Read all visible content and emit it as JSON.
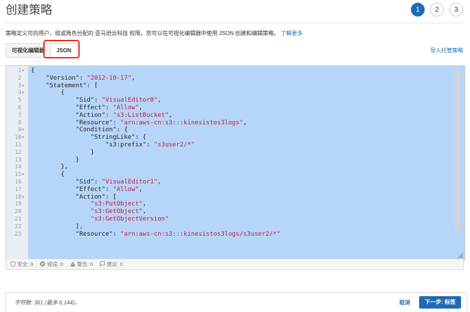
{
  "header": {
    "title": "创建策略",
    "steps": [
      "1",
      "2",
      "3"
    ]
  },
  "description": {
    "text": "策略定义可向用户、组或角色分配的 亚马逊云科技 权限。您可以在可视化编辑器中使用 JSON 创建和编辑策略。",
    "link": "了解更多"
  },
  "tabs": {
    "visual": "可视化编辑器",
    "json": "JSON"
  },
  "import_link": "导入托管策略",
  "editor": {
    "lines": [
      {
        "n": "1",
        "fold": true,
        "t": [
          [
            "p",
            "{"
          ]
        ]
      },
      {
        "n": "2",
        "t": [
          [
            "p",
            "    \"Version\": "
          ],
          [
            "s",
            "\"2012-10-17\""
          ],
          [
            "p",
            ","
          ]
        ]
      },
      {
        "n": "3",
        "fold": true,
        "t": [
          [
            "p",
            "    \"Statement\": ["
          ]
        ]
      },
      {
        "n": "4",
        "fold": true,
        "t": [
          [
            "p",
            "        {"
          ]
        ]
      },
      {
        "n": "5",
        "t": [
          [
            "p",
            "            \"Sid\": "
          ],
          [
            "s",
            "\"VisualEditor0\""
          ],
          [
            "p",
            ","
          ]
        ]
      },
      {
        "n": "6",
        "t": [
          [
            "p",
            "            \"Effect\": "
          ],
          [
            "s",
            "\"Allow\""
          ],
          [
            "p",
            ","
          ]
        ]
      },
      {
        "n": "7",
        "t": [
          [
            "p",
            "            \"Action\": "
          ],
          [
            "s",
            "\"s3:ListBucket\""
          ],
          [
            "p",
            ","
          ]
        ]
      },
      {
        "n": "8",
        "t": [
          [
            "p",
            "            \"Resource\": "
          ],
          [
            "s",
            "\"arn:aws-cn:s3:::kinesistos3logs\""
          ],
          [
            "p",
            ","
          ]
        ]
      },
      {
        "n": "9",
        "fold": true,
        "t": [
          [
            "p",
            "            \"Condition\": {"
          ]
        ]
      },
      {
        "n": "10",
        "fold": true,
        "t": [
          [
            "p",
            "                \"StringLike\": {"
          ]
        ]
      },
      {
        "n": "11",
        "t": [
          [
            "p",
            "                    \"s3:prefix\": "
          ],
          [
            "s",
            "\"s3user2/*\""
          ]
        ]
      },
      {
        "n": "12",
        "t": [
          [
            "p",
            "                }"
          ]
        ]
      },
      {
        "n": "13",
        "t": [
          [
            "p",
            "            }"
          ]
        ]
      },
      {
        "n": "14",
        "t": [
          [
            "p",
            "        },"
          ]
        ]
      },
      {
        "n": "15",
        "fold": true,
        "t": [
          [
            "p",
            "        {"
          ]
        ]
      },
      {
        "n": "16",
        "t": [
          [
            "p",
            "            \"Sid\": "
          ],
          [
            "s",
            "\"VisualEditor1\""
          ],
          [
            "p",
            ","
          ]
        ]
      },
      {
        "n": "17",
        "t": [
          [
            "p",
            "            \"Effect\": "
          ],
          [
            "s",
            "\"Allow\""
          ],
          [
            "p",
            ","
          ]
        ]
      },
      {
        "n": "18",
        "fold": true,
        "t": [
          [
            "p",
            "            \"Action\": ["
          ]
        ]
      },
      {
        "n": "19",
        "t": [
          [
            "s",
            "                \"s3:PutObject\""
          ],
          [
            "p",
            ","
          ]
        ]
      },
      {
        "n": "20",
        "t": [
          [
            "s",
            "                \"s3:GetObject\""
          ],
          [
            "p",
            ","
          ]
        ]
      },
      {
        "n": "21",
        "t": [
          [
            "s",
            "                \"s3:GetObjectVersion\""
          ]
        ]
      },
      {
        "n": "22",
        "t": [
          [
            "p",
            "            ],"
          ]
        ]
      },
      {
        "n": "23",
        "t": [
          [
            "p",
            "            \"Resource\": "
          ],
          [
            "s",
            "\"arn:aws-cn:s3:::kinesistos3logs/s3user2/*\""
          ]
        ]
      }
    ]
  },
  "status": {
    "security": "安全: 0",
    "errors": "错误: 0",
    "warnings": "警告: 0",
    "suggestions": "建议: 0"
  },
  "footer": {
    "char_count": "字符数: 361 (最多 6,144)。",
    "cancel": "取消",
    "next": "下一步: 标签"
  },
  "colors": {
    "accent": "#1f6bb3",
    "highlight_box": "#e8321f",
    "selection": "#b6d6f9",
    "string": "#c21b3a"
  }
}
